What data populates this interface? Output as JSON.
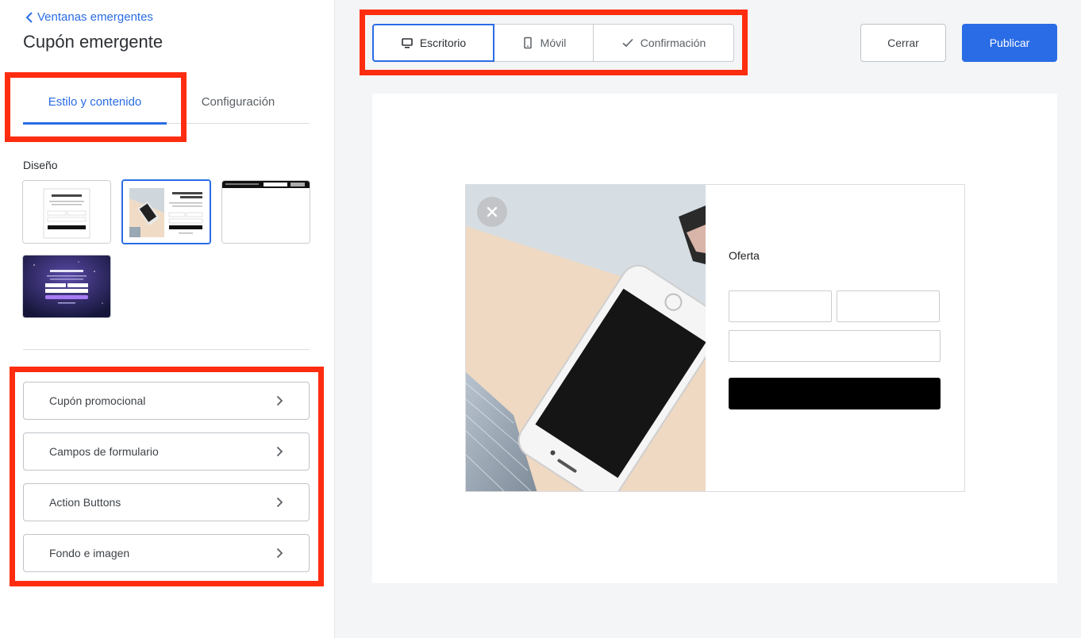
{
  "sidebar": {
    "back_label": "Ventanas emergentes",
    "title": "Cupón emergente",
    "tabs": [
      {
        "label": "Estilo y contenido",
        "active": true
      },
      {
        "label": "Configuración",
        "active": false
      }
    ],
    "design_label": "Diseño",
    "design_thumbnails": [
      {
        "name": "centered-white",
        "selected": false
      },
      {
        "name": "image-left",
        "selected": true
      },
      {
        "name": "top-banner",
        "selected": false
      },
      {
        "name": "dark-background",
        "selected": false
      }
    ],
    "sections": [
      {
        "label": "Cupón promocional"
      },
      {
        "label": "Campos de formulario"
      },
      {
        "label": "Action Buttons"
      },
      {
        "label": "Fondo e imagen"
      }
    ]
  },
  "toolbar": {
    "views": [
      {
        "label": "Escritorio",
        "icon": "desktop-icon",
        "active": true
      },
      {
        "label": "Móvil",
        "icon": "mobile-icon",
        "active": false
      },
      {
        "label": "Confirmación",
        "icon": "check-icon",
        "active": false
      }
    ],
    "close_label": "Cerrar",
    "publish_label": "Publicar"
  },
  "preview": {
    "offer_text": "Oferta"
  },
  "colors": {
    "accent": "#2a6ce6",
    "highlight": "#ff2d10",
    "submit_button": "#000000"
  }
}
